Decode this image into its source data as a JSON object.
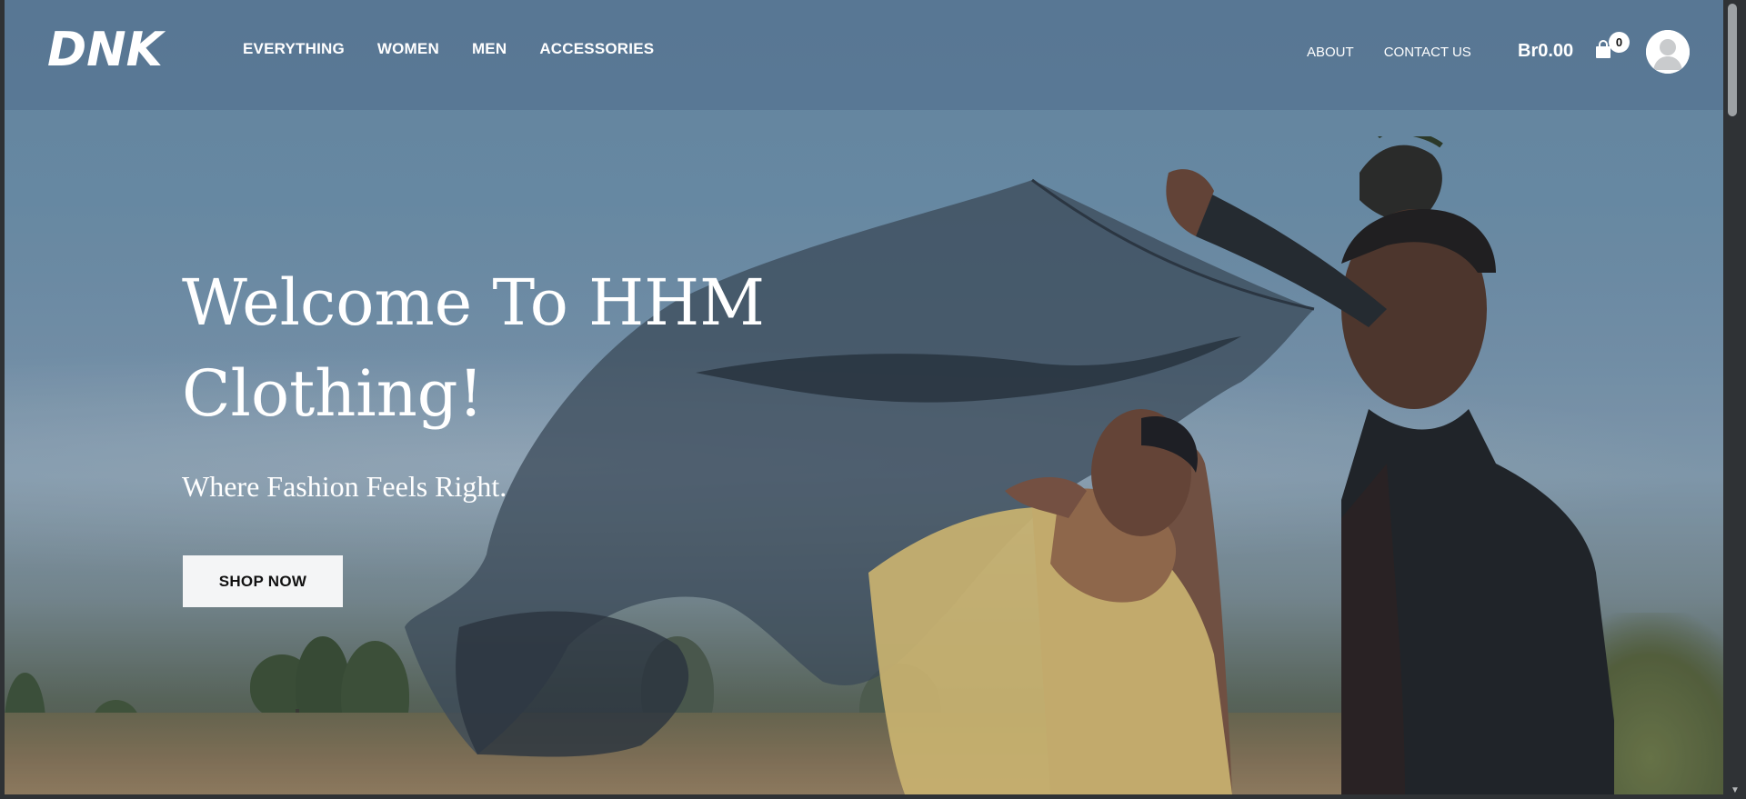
{
  "header": {
    "logo_text": "DNK",
    "nav": [
      "EVERYTHING",
      "WOMEN",
      "MEN",
      "ACCESSORIES"
    ],
    "nav_right": [
      "ABOUT",
      "CONTACT US"
    ],
    "cart_total": "Br0.00",
    "cart_count": "0"
  },
  "hero": {
    "title_line1": "Welcome To HHM",
    "title_line2": "Clothing!",
    "subtitle": "Where Fashion Feels Right.",
    "cta_label": "SHOP NOW"
  },
  "icons": {
    "cart": "shopping-bag-icon",
    "avatar": "user-avatar-icon"
  }
}
